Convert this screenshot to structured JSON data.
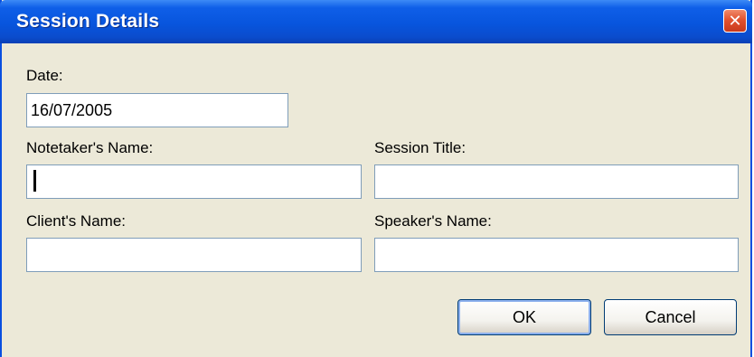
{
  "window": {
    "title": "Session Details",
    "close_glyph": "✕"
  },
  "form": {
    "date_label": "Date:",
    "date_value": "16/07/2005",
    "notetaker_label": "Notetaker's Name:",
    "notetaker_value": "",
    "session_title_label": "Session Title:",
    "session_title_value": "",
    "client_label": "Client's Name:",
    "client_value": "",
    "speaker_label": "Speaker's Name:",
    "speaker_value": ""
  },
  "buttons": {
    "ok_label": "OK",
    "cancel_label": "Cancel"
  },
  "colors": {
    "titlebar": "#0855dd",
    "dialog_bg": "#ece9d8",
    "field_border": "#7f9db9",
    "close_button": "#e2522f"
  }
}
